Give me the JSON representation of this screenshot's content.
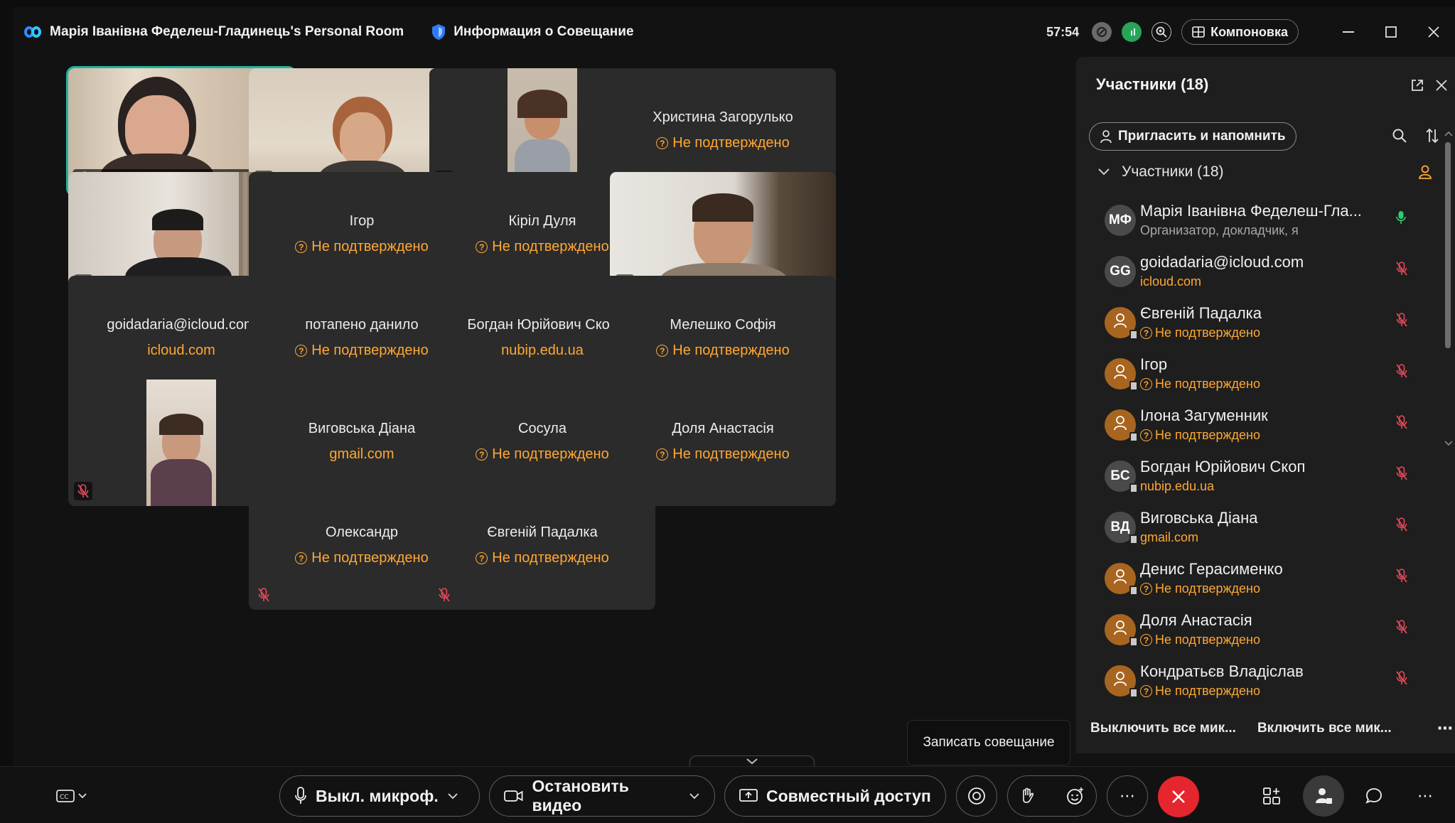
{
  "title_bar": {
    "room_name": "Марія Іванівна Феделеш-Гладинець's Personal Room",
    "meeting_info_label": "Информация о Совещание",
    "timer": "57:54",
    "layout_label": "Компоновка"
  },
  "grid": [
    {
      "kind": "video",
      "name": "Марія Іванівна Феделеш-...",
      "active": true,
      "mic_on": true
    },
    {
      "kind": "video",
      "name": "",
      "active": false,
      "mic_on": false
    },
    {
      "kind": "video",
      "name": "",
      "active": false,
      "mic_on": false
    },
    {
      "kind": "text",
      "name": "Христина Загорулько",
      "sub": "Не подтверждено",
      "warn": true
    },
    {
      "kind": "video",
      "name": "",
      "mic_on": false
    },
    {
      "kind": "text",
      "name": "Ігор",
      "sub": "Не подтверждено",
      "warn": true
    },
    {
      "kind": "text",
      "name": "Кіріл Дуля",
      "sub": "Не подтверждено",
      "warn": true
    },
    {
      "kind": "video",
      "name": "",
      "mic_on": false
    },
    {
      "kind": "text",
      "name": "goidadaria@icloud.com",
      "sub": "icloud.com",
      "warn": false
    },
    {
      "kind": "text",
      "name": "потапено данило",
      "sub": "Не подтверждено",
      "warn": true
    },
    {
      "kind": "text",
      "name": "Богдан Юрійович Скоп",
      "sub": "nubip.edu.ua",
      "warn": false
    },
    {
      "kind": "text",
      "name": "Мелешко Софія",
      "sub": "Не подтверждено",
      "warn": true
    },
    {
      "kind": "video",
      "name": "",
      "mic_on": false
    },
    {
      "kind": "text",
      "name": "Виговська Діана",
      "sub": "gmail.com",
      "warn": false
    },
    {
      "kind": "text",
      "name": "Сосула",
      "sub": "Не подтверждено",
      "warn": true
    },
    {
      "kind": "text",
      "name": "Доля Анастасія",
      "sub": "Не подтверждено",
      "warn": true
    },
    {
      "kind": "text",
      "name": "Олександр",
      "sub": "Не подтверждено",
      "warn": true
    },
    {
      "kind": "text",
      "name": "Євгеній Падалка",
      "sub": "Не подтверждено",
      "warn": true
    }
  ],
  "panel": {
    "title": "Участники (18)",
    "invite_label": "Пригласить и напомнить",
    "section_label": "Участники (18)",
    "participants": [
      {
        "initials": "МФ",
        "avatar": "gray",
        "name": "Марія Іванівна Феделеш-Гла...",
        "sub": "Организатор, докладчик, я",
        "sub_style": "gray",
        "mic_on": true
      },
      {
        "initials": "GG",
        "avatar": "gray",
        "name": "goidadaria@icloud.com",
        "sub": "icloud.com",
        "sub_style": "orange",
        "mic_on": false
      },
      {
        "initials": "",
        "avatar": "orange",
        "name": "Євгеній Падалка",
        "sub": "Не подтверждено",
        "sub_style": "warn",
        "mic_on": false
      },
      {
        "initials": "",
        "avatar": "orange",
        "name": "Ігор",
        "sub": "Не подтверждено",
        "sub_style": "warn",
        "mic_on": false
      },
      {
        "initials": "",
        "avatar": "orange",
        "name": "Ілона Загуменник",
        "sub": "Не подтверждено",
        "sub_style": "warn",
        "mic_on": false
      },
      {
        "initials": "БС",
        "avatar": "gray",
        "name": "Богдан Юрійович Скоп",
        "sub": "nubip.edu.ua",
        "sub_style": "orange",
        "mic_on": false
      },
      {
        "initials": "ВД",
        "avatar": "gray",
        "name": "Виговська Діана",
        "sub": "gmail.com",
        "sub_style": "orange",
        "mic_on": false
      },
      {
        "initials": "",
        "avatar": "orange",
        "name": "Денис Герасименко",
        "sub": "Не подтверждено",
        "sub_style": "warn",
        "mic_on": false
      },
      {
        "initials": "",
        "avatar": "orange",
        "name": "Доля Анастасія",
        "sub": "Не подтверждено",
        "sub_style": "warn",
        "mic_on": false
      },
      {
        "initials": "",
        "avatar": "orange",
        "name": "Кондратьєв Владіслав",
        "sub": "Не подтверждено",
        "sub_style": "warn",
        "mic_on": false
      }
    ],
    "mute_all_label": "Выключить все мик...",
    "unmute_all_label": "Включить все мик..."
  },
  "tooltip": "Записать совещание",
  "toolbar": {
    "mic_label": "Выкл. микроф.",
    "video_label": "Остановить видео",
    "share_label": "Совместный доступ"
  },
  "colors": {
    "accent": "#1fb5a0",
    "warn": "#ffa733",
    "danger": "#e5262f",
    "mic_off": "#e8485a",
    "mic_on": "#2ecc71"
  }
}
